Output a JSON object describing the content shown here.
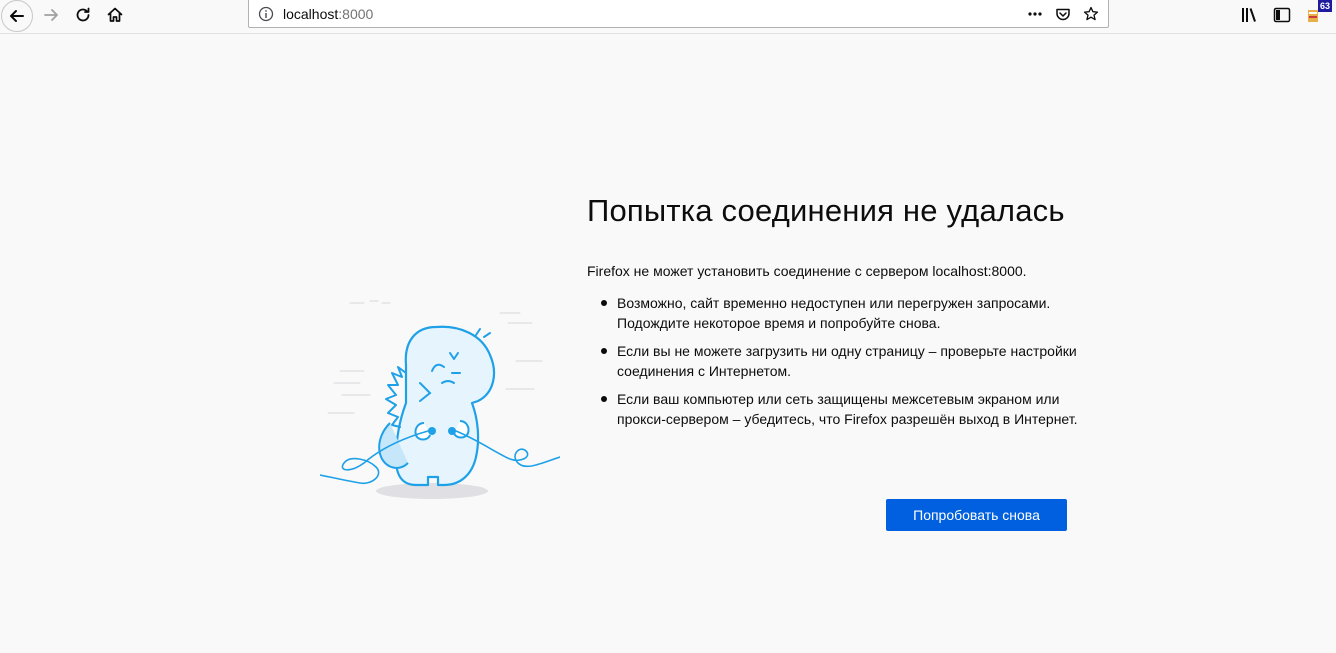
{
  "toolbar": {
    "url_host": "localhost",
    "url_port": ":8000",
    "addon_badge": "63"
  },
  "error": {
    "title": "Попытка соединения не удалась",
    "lead": "Firefox не может установить соединение с сервером localhost:8000.",
    "tips": [
      "Возможно, сайт временно недоступен или перегружен запросами. Подождите некоторое время и попробуйте снова.",
      "Если вы не можете загрузить ни одну страницу – проверьте настройки соединения с Интернетом.",
      "Если ваш компьютер или сеть защищены межсетевым экраном или прокси-сервером – убедитесь, что Firefox разрешён выход в Интернет."
    ],
    "retry_label": "Попробовать снова"
  },
  "colors": {
    "accent": "#0060df",
    "illustration": "#1fa1e8",
    "background": "#f9f9fa"
  },
  "icons": {
    "back": "arrow-left-icon",
    "forward": "arrow-right-icon",
    "reload": "reload-icon",
    "home": "home-icon",
    "info": "info-icon",
    "page_actions": "more-dots-icon",
    "pocket": "pocket-icon",
    "bookmark": "star-icon",
    "library": "library-icon",
    "sidebar": "sidebar-icon",
    "addon": "addon-icon"
  }
}
